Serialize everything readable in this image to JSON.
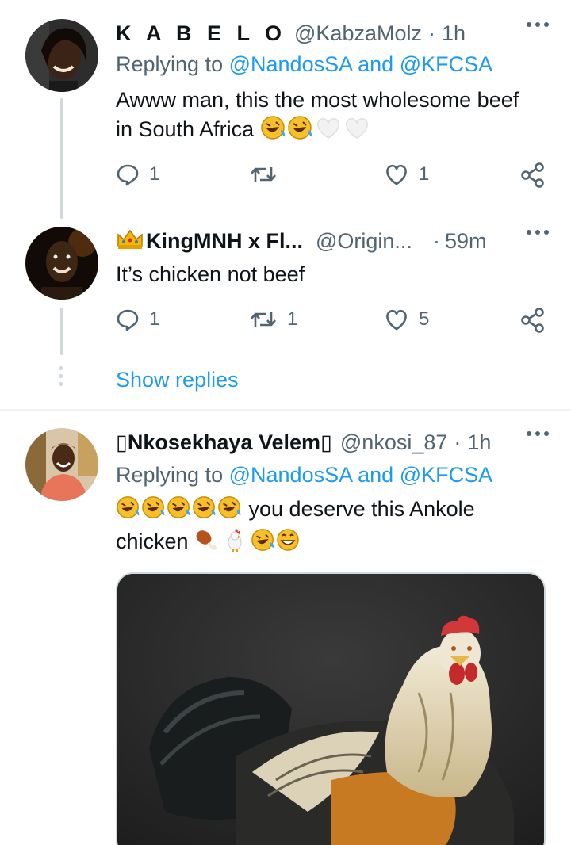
{
  "tweets": [
    {
      "name": "K A B E L O",
      "handle": "@KabzaMolz",
      "dot": "·",
      "time": "1h",
      "replying_prefix": "Replying to",
      "replying_user1": "@NandosSA",
      "replying_and": "and",
      "replying_user2": "@KFCSA",
      "text_line1": "Awww man, this the most wholesome beef",
      "text_line2": "in South Africa",
      "emojis": [
        "rolling-laughing-emoji",
        "rolling-laughing-emoji",
        "white-heart-emoji",
        "white-heart-emoji"
      ],
      "reply_count": "1",
      "retweet_count": "",
      "like_count": "1"
    },
    {
      "name": "KingMNH x Fl...",
      "handle": "@Origin...",
      "dot": "·",
      "time": "59m",
      "text": "It’s chicken not beef",
      "badge": "crown-emoji",
      "reply_count": "1",
      "retweet_count": "1",
      "like_count": "5"
    },
    {
      "name": "Nkosekhaya Velem",
      "name_glyph": "▯",
      "handle": "@nkosi_87",
      "dot": "·",
      "time": "1h",
      "replying_prefix": "Replying to",
      "replying_user1": "@NandosSA",
      "replying_and": "and",
      "replying_user2": "@KFCSA",
      "text_line1_suffix": "you deserve this Ankole",
      "text_line2": "chicken",
      "media_description": "rooster-photo"
    }
  ],
  "show_replies": "Show replies",
  "colors": {
    "link": "#1d9bf0",
    "secondary": "#536471",
    "primary": "#0f1419",
    "divider": "#eff3f4",
    "thread_line": "#cfd9de"
  },
  "icons": [
    "reply-icon",
    "retweet-icon",
    "like-icon",
    "share-icon",
    "more-icon"
  ]
}
